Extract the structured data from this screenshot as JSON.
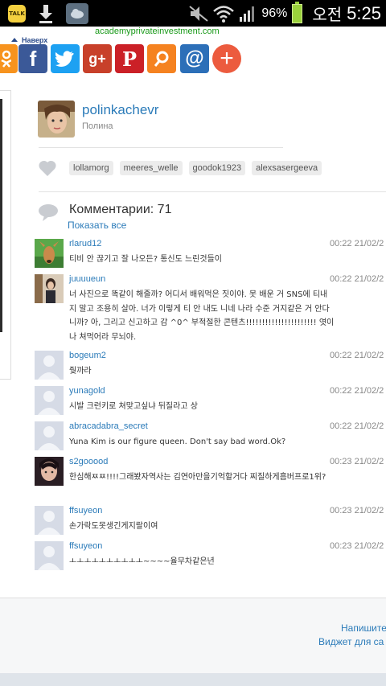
{
  "status_bar": {
    "talk_icon_label": "TALK",
    "battery_percent": "96%",
    "ampm": "오전",
    "clock": "5:25",
    "battery_color": "#9ad13c"
  },
  "share": {
    "site_link": "academyprivateinvestment.com",
    "back_to_top": "Наверх",
    "buttons": [
      {
        "name": "odnoklassniki",
        "glyph": "ok",
        "color": "#f7931e"
      },
      {
        "name": "facebook",
        "glyph": "f",
        "color": "#3b5998"
      },
      {
        "name": "twitter",
        "glyph": "t",
        "color": "#1da1f2"
      },
      {
        "name": "google-plus",
        "glyph": "g+",
        "color": "#c8402a"
      },
      {
        "name": "pinterest",
        "glyph": "P",
        "color": "#cb2027"
      },
      {
        "name": "search",
        "glyph": "search",
        "color": "#f58220"
      },
      {
        "name": "email",
        "glyph": "@",
        "color": "#2c6fb8"
      },
      {
        "name": "more",
        "glyph": "+",
        "color": "#ec5b3e"
      }
    ]
  },
  "author": {
    "username": "polinkachevr",
    "display_name": "Полина"
  },
  "likes": {
    "tags": [
      "lollamorg",
      "meeres_welle",
      "goodok1923",
      "alexsasergeeva"
    ]
  },
  "comments": {
    "title": "Комментарии: 71",
    "show_all": "Показать все",
    "items": [
      {
        "user": "rlarud12",
        "time": "00:22 21/02/2",
        "text": "티비 안 끊기고 잘 나오든? 통신도 느린것들이",
        "avatar": "deer"
      },
      {
        "user": "juuuueun",
        "time": "00:22 21/02/2",
        "text": "너 사진으로 똑같이 해줄까? 어디서 배워먹은 짓이야. 못 배운 거 SNS에 티내지 말고 조용히 살아. 너가 이렇게 티 안 내도 니네 나라 수준 거지같은 거 안다니까? 아, 그리고 신고하고 감 ^0^ 부적절한 콘텐츠!!!!!!!!!!!!!!!!!!!!!! 엿이나 쳐먹어라 무뇌야.",
        "avatar": "girl"
      },
      {
        "user": "bogeum2",
        "time": "00:22 21/02/2",
        "text": "줮까라",
        "avatar": "blank"
      },
      {
        "user": "yunagold",
        "time": "00:22 21/02/2",
        "text": "시발 크런키로 쳐맞고싶냐 뒤질라고 상",
        "avatar": "blank"
      },
      {
        "user": "abracadabra_secret",
        "time": "00:22 21/02/2",
        "text": "Yuna Kim is our figure queen. Don't say bad word.Ok?",
        "avatar": "blank"
      },
      {
        "user": "s2gooood",
        "time": "00:23 21/02/2",
        "text": "한심해ㅉㅉ!!!!그래봤자역사는 김연아만을기억할거다 찌질하게흠버프로1위?",
        "avatar": "boy"
      },
      {
        "user": "ffsuyeon",
        "time": "00:23 21/02/2",
        "text": "손가락도못생긴게지랄이여",
        "avatar": "blank"
      },
      {
        "user": "ffsuyeon",
        "time": "00:23 21/02/2",
        "text": "ㅗㅗㅗㅗㅗㅗㅗㅗㅗㅗ~~~~율무차같은년",
        "avatar": "blank"
      }
    ]
  },
  "footer": {
    "write_link": "Напишите",
    "widget_link": "Виджет для са"
  }
}
